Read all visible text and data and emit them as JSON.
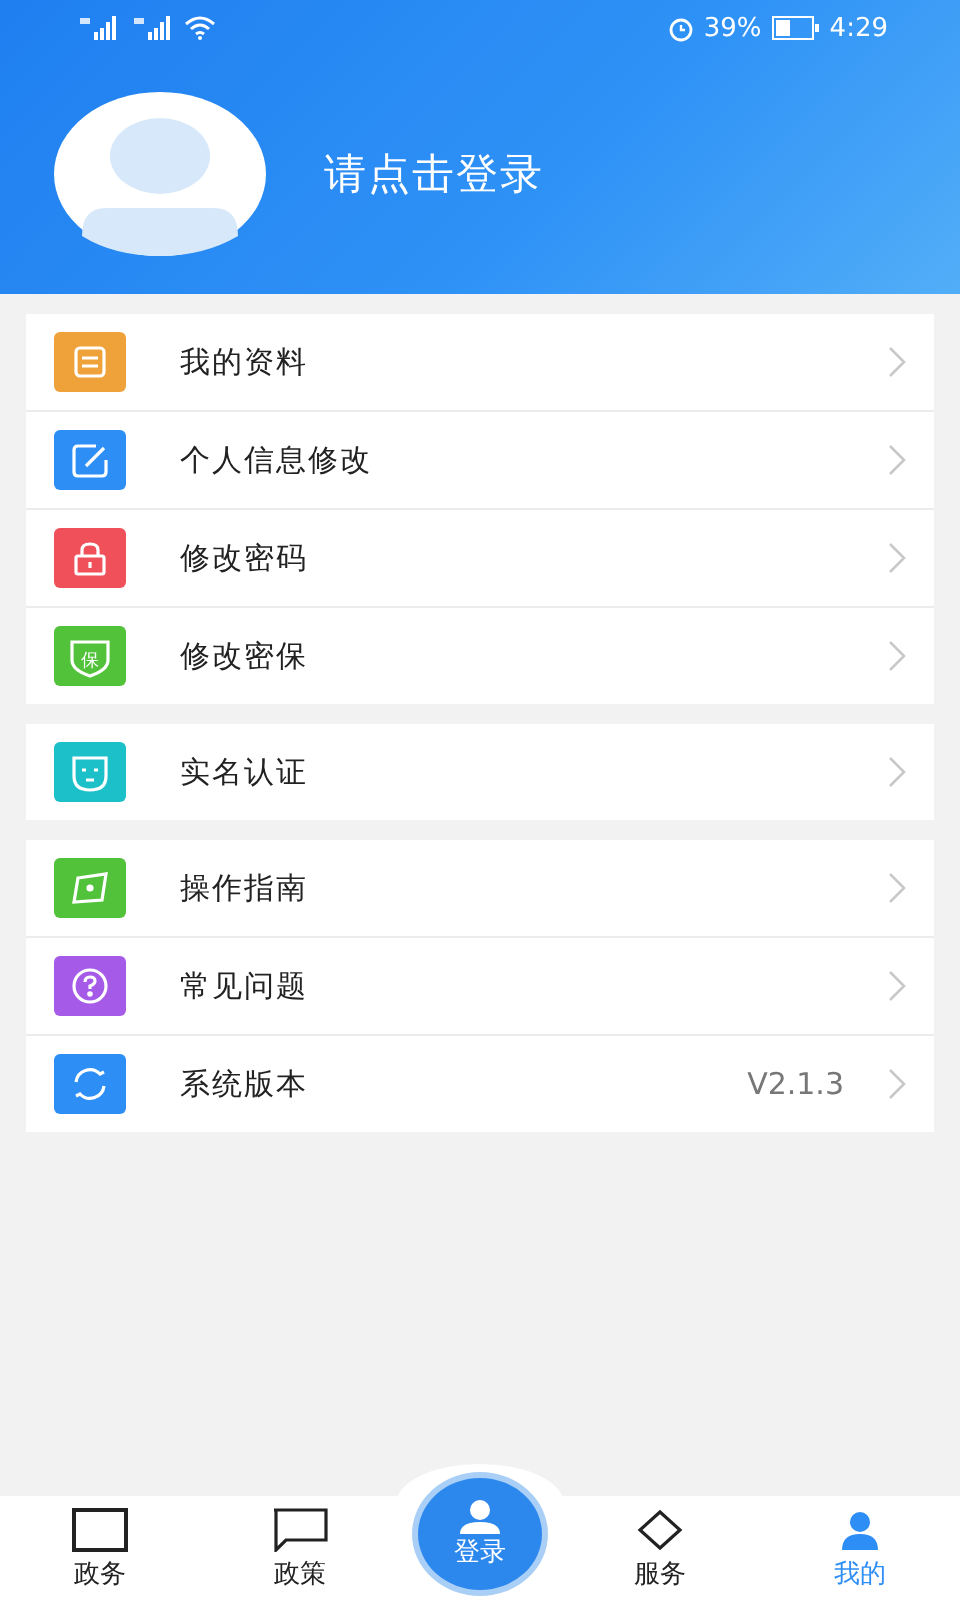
{
  "status_bar": {
    "battery": "39%",
    "time": "4:29"
  },
  "header": {
    "login_prompt": "请点击登录"
  },
  "sections": [
    [
      {
        "label": "我的资料",
        "color": "#f0a23a",
        "kind": "form"
      },
      {
        "label": "个人信息修改",
        "color": "#2d8ef5",
        "kind": "edit"
      },
      {
        "label": "修改密码",
        "color": "#f0505a",
        "kind": "lock"
      },
      {
        "label": "修改密保",
        "color": "#52c23a",
        "kind": "shield",
        "icon_text": "保"
      }
    ],
    [
      {
        "label": "实名认证",
        "color": "#1cc0c8",
        "kind": "face"
      }
    ],
    [
      {
        "label": "操作指南",
        "color": "#52c23a",
        "kind": "compass"
      },
      {
        "label": "常见问题",
        "color": "#a55ae8",
        "kind": "question"
      },
      {
        "label": "系统版本",
        "color": "#2d8ef5",
        "kind": "refresh",
        "value": "V2.1.3"
      }
    ]
  ],
  "bottom_nav": [
    {
      "label": "政务",
      "kind": "tab",
      "selected": false
    },
    {
      "label": "政策",
      "kind": "tab",
      "selected": false
    },
    {
      "label": "登录",
      "kind": "center",
      "selected": false
    },
    {
      "label": "服务",
      "kind": "tab",
      "selected": false
    },
    {
      "label": "我的",
      "kind": "tab",
      "selected": true
    }
  ]
}
